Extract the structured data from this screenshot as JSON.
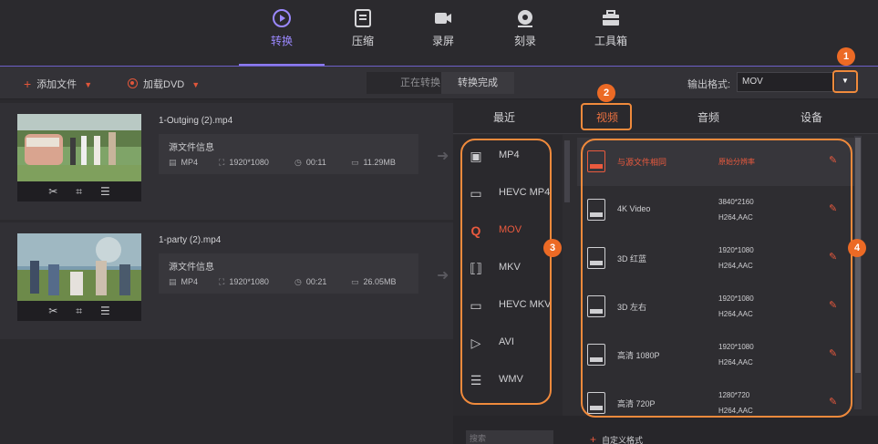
{
  "nav": {
    "items": [
      {
        "label": "转换",
        "icon": "convert-icon"
      },
      {
        "label": "压缩",
        "icon": "compress-icon"
      },
      {
        "label": "录屏",
        "icon": "record-screen-icon"
      },
      {
        "label": "刻录",
        "icon": "burn-disc-icon"
      },
      {
        "label": "工具箱",
        "icon": "toolbox-icon"
      }
    ],
    "active_color": "#9b88ff"
  },
  "toolbar": {
    "add_file": "添加文件",
    "load_dvd": "加载DVD",
    "tab_converting": "正在转换",
    "tab_converted": "转换完成",
    "output_label": "输出格式:",
    "output_value": "MOV"
  },
  "files": [
    {
      "name": "1-Outging (2).mp4",
      "info_title": "源文件信息",
      "format": "MP4",
      "resolution": "1920*1080",
      "duration": "00:11",
      "size": "11.29MB"
    },
    {
      "name": "1-party (2).mp4",
      "info_title": "源文件信息",
      "format": "MP4",
      "resolution": "1920*1080",
      "duration": "00:21",
      "size": "26.05MB"
    }
  ],
  "panel": {
    "tabs": [
      "最近",
      "视频",
      "音频",
      "设备"
    ],
    "active_tab": "视频",
    "categories": [
      {
        "label": "MP4",
        "icon": "film-icon"
      },
      {
        "label": "HEVC MP4",
        "icon": "hevc-icon"
      },
      {
        "label": "MOV",
        "icon": "quicktime-icon"
      },
      {
        "label": "MKV",
        "icon": "mkv-icon"
      },
      {
        "label": "HEVC MKV",
        "icon": "hevc-icon"
      },
      {
        "label": "AVI",
        "icon": "play-circle-icon"
      },
      {
        "label": "WMV",
        "icon": "wmv-icon"
      }
    ],
    "presets": [
      {
        "name": "与源文件相同",
        "res": "原始分辨率",
        "codec": ""
      },
      {
        "name": "4K Video",
        "res": "3840*2160",
        "codec": "H264,AAC"
      },
      {
        "name": "3D 红蓝",
        "res": "1920*1080",
        "codec": "H264,AAC"
      },
      {
        "name": "3D 左右",
        "res": "1920*1080",
        "codec": "H264,AAC"
      },
      {
        "name": "高清 1080P",
        "res": "1920*1080",
        "codec": "H264,AAC"
      },
      {
        "name": "高清 720P",
        "res": "1280*720",
        "codec": "H264,AAC"
      }
    ],
    "search_placeholder": "搜索",
    "custom_label": "自定义格式",
    "accent_color": "#ea5a3e"
  },
  "markers": [
    "1",
    "2",
    "3",
    "4"
  ]
}
